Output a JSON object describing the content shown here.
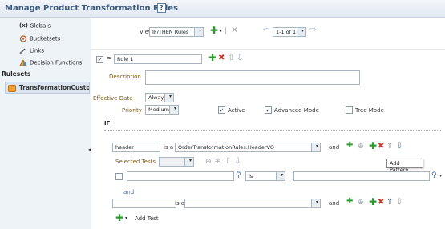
{
  "header": {
    "title": "Manage Product Transformation Rules",
    "help_icon": "?"
  },
  "sidebar": {
    "items": [
      {
        "label": "Globals",
        "icon": "x-icon"
      },
      {
        "label": "Bucketsets",
        "icon": "bucketsets-icon"
      },
      {
        "label": "Links",
        "icon": "links-icon"
      },
      {
        "label": "Decision Functions",
        "icon": "decision-functions-icon"
      }
    ],
    "rulesets_label": "Rulesets",
    "ruleset": "TransformationCusto"
  },
  "toolbar": {
    "view_label": "View",
    "view_value": "IF/THEN Rules",
    "pager_value": "1-1 of 1"
  },
  "rule": {
    "name": "Rule 1",
    "description_label": "Description",
    "description_value": "",
    "effective_date_label": "Effective Date",
    "effective_date_value": "Always",
    "priority_label": "Priority",
    "priority_value": "Medium",
    "active_label": "Active",
    "advanced_mode_label": "Advanced Mode",
    "tree_mode_label": "Tree Mode"
  },
  "if_block": {
    "if_label": "IF",
    "pattern_var": "header",
    "is_a_label": "is a",
    "pattern_type": "OrderTransformationRules.HeaderVO",
    "and_label": "and",
    "selected_tests_label": "Selected Tests",
    "operator": "is",
    "and2_label": "and",
    "is_a2_label": "is a",
    "add_test_label": "Add Test"
  },
  "tooltip": {
    "text": "Add Pattern"
  },
  "colors": {
    "accent": "#3c5a7e",
    "add_green": "#2d9a2d",
    "delete_red": "#c0392b"
  }
}
